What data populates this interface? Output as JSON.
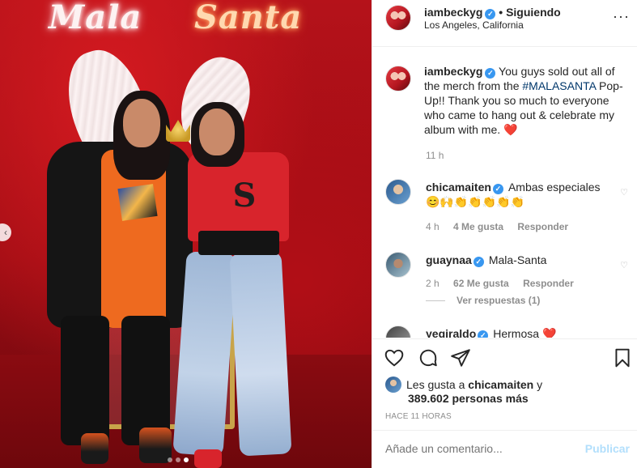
{
  "photo": {
    "sign_left": "Mala",
    "sign_right": "Santa",
    "carousel": {
      "count": 3,
      "active_index": 2
    }
  },
  "header": {
    "username": "iambeckyg",
    "separator": "•",
    "follow_status": "Siguiendo",
    "location": "Los Angeles, California",
    "more_icon": "more-horizontal-icon"
  },
  "caption": {
    "username": "iambeckyg",
    "text_before": "You guys sold out all of the merch from the ",
    "hashtag": "#MALASANTA",
    "text_after": " Pop-Up!! Thank you so much to everyone who came to hang out & celebrate my album with me. ",
    "emoji": "❤️",
    "time": "11 h"
  },
  "comments": [
    {
      "username": "chicamaiten",
      "verified": true,
      "text": "Ambas especiales",
      "emoji_line": "😊🙌👏👏👏👏👏",
      "time": "4 h",
      "likes": "4 Me gusta",
      "reply": "Responder"
    },
    {
      "username": "guaynaa",
      "verified": true,
      "text": "Mala-Santa",
      "time": "2 h",
      "likes": "62 Me gusta",
      "reply": "Responder",
      "replies": "Ver respuestas (1)"
    },
    {
      "username": "yegiraldo",
      "verified": true,
      "text": "Hermosa ",
      "emoji": "❤️"
    }
  ],
  "actions": {
    "icons": [
      "heart-icon",
      "comment-icon",
      "share-icon",
      "bookmark-icon"
    ],
    "likes_prefix": "Les gusta a ",
    "likes_user": "chicamaiten",
    "likes_suffix": " y",
    "likes_count": "389.602 personas más",
    "posted_time": "HACE 11 HORAS"
  },
  "add_comment": {
    "placeholder": "Añade un comentario...",
    "publish_label": "Publicar"
  },
  "colors": {
    "link": "#00376b",
    "verified": "#3897f0",
    "publish_disabled": "#b2dffc",
    "muted": "#8e8e8e"
  }
}
